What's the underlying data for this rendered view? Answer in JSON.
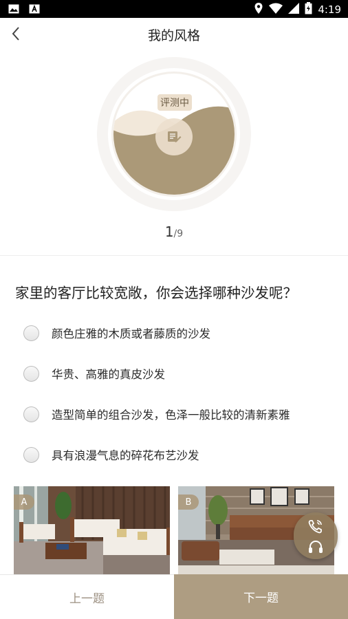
{
  "status_bar": {
    "time": "4:19",
    "icons": [
      "image-icon",
      "text-icon",
      "location-icon",
      "wifi-icon",
      "signal-icon",
      "battery-icon"
    ]
  },
  "header": {
    "title": "我的风格"
  },
  "gauge": {
    "badge": "评测中",
    "fill_percent": 58,
    "icon": "edit-document-icon"
  },
  "progress": {
    "current": "1",
    "total": "/9"
  },
  "question": {
    "text": "家里的客厅比较宽敞，你会选择哪种沙发呢？"
  },
  "options": [
    {
      "label": "颜色庄雅的木质或者藤质的沙发",
      "selected": false
    },
    {
      "label": "华贵、高雅的真皮沙发",
      "selected": false
    },
    {
      "label": "造型简单的组合沙发，色泽一般比较的清新素雅",
      "selected": false
    },
    {
      "label": "具有浪漫气息的碎花布艺沙发",
      "selected": false
    }
  ],
  "photos": [
    {
      "tag": "A"
    },
    {
      "tag": "B"
    }
  ],
  "float_contact": {
    "icons": [
      "phone-icon",
      "headset-icon"
    ]
  },
  "footer": {
    "prev_label": "上一题",
    "next_label": "下一题"
  },
  "colors": {
    "accent": "#ae9d82",
    "gauge_fill": "#ab9978",
    "gauge_ring": "#f3f0ee"
  }
}
